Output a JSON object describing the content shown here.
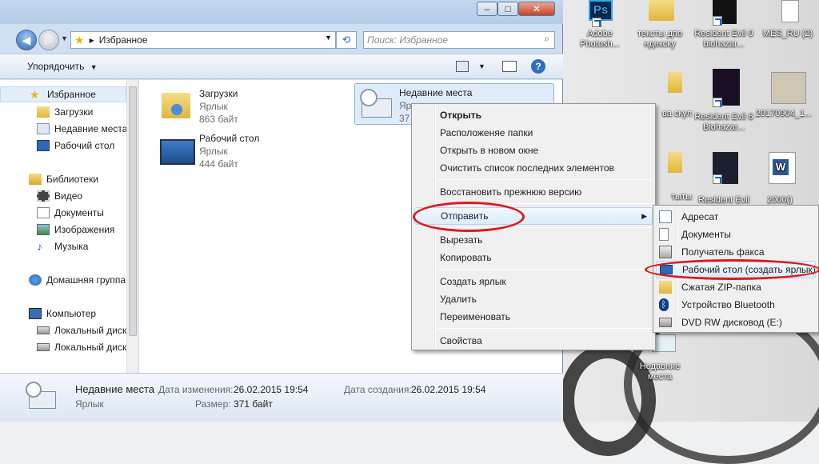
{
  "desktop": {
    "icons": [
      {
        "label": "Adobe Photosh...",
        "icon": "photoshop-icon"
      },
      {
        "label": "тексты дпо ндекску",
        "icon": "folder-icon"
      },
      {
        "label": "Resident Evil 0 biohazar...",
        "icon": "game-icon"
      },
      {
        "label": "MES_RU (2)",
        "icon": "document-icon"
      },
      {
        "label": "Resident Evil 6 Biohazar...",
        "icon": "game-icon"
      },
      {
        "label": "20170904_1...",
        "icon": "image-icon"
      },
      {
        "label": "ва скул",
        "icon": "folder-icon"
      },
      {
        "label": "Resident Evil",
        "icon": "game-icon"
      },
      {
        "label": "2000()",
        "icon": "word-document-icon"
      },
      {
        "label": "тыты",
        "icon": "folder-icon"
      },
      {
        "label": "Недавние места",
        "icon": "recent-places-icon"
      }
    ],
    "ps_logo": "Ps",
    "word_logo": "W"
  },
  "explorer": {
    "address": {
      "path": "Избранное",
      "breadcrumb_sep": "▶"
    },
    "search": {
      "placeholder": "Поиск: Избранное"
    },
    "toolbar": {
      "organize_label": "Упорядочить"
    },
    "nav": [
      {
        "label": "Избранное",
        "icon": "star-icon",
        "level": 0
      },
      {
        "label": "Загрузки",
        "icon": "downloads-folder-icon",
        "level": 1
      },
      {
        "label": "Недавние места",
        "icon": "recent-places-icon",
        "level": 1
      },
      {
        "label": "Рабочий стол",
        "icon": "desktop-icon",
        "level": 1
      },
      {
        "label": "Библиотеки",
        "icon": "libraries-icon",
        "level": 0
      },
      {
        "label": "Видео",
        "icon": "video-icon",
        "level": 1
      },
      {
        "label": "Документы",
        "icon": "documents-icon",
        "level": 1
      },
      {
        "label": "Изображения",
        "icon": "pictures-icon",
        "level": 1
      },
      {
        "label": "Музыка",
        "icon": "music-icon",
        "level": 1
      },
      {
        "label": "Домашняя группа",
        "icon": "homegroup-icon",
        "level": 0
      },
      {
        "label": "Компьютер",
        "icon": "computer-icon",
        "level": 0
      },
      {
        "label": "Локальный диск",
        "icon": "drive-icon",
        "level": 1
      },
      {
        "label": "Локальный диск",
        "icon": "drive-icon",
        "level": 1
      }
    ],
    "files": [
      {
        "name": "Загрузки",
        "type": "Ярлык",
        "size": "863 байт",
        "icon": "downloads-folder-icon"
      },
      {
        "name": "Рабочий стол",
        "type": "Ярлык",
        "size": "444 байт",
        "icon": "desktop-icon"
      },
      {
        "name": "Недавние места",
        "type": "Ярлык",
        "size": "37",
        "icon": "recent-places-icon"
      }
    ],
    "details": {
      "name": "Недавние места",
      "type": "Ярлык",
      "modified_label": "Дата изменения:",
      "modified_value": "26.02.2015 19:54",
      "size_label": "Размер:",
      "size_value": "371 байт",
      "created_label": "Дата создания:",
      "created_value": "26.02.2015 19:54"
    }
  },
  "context_menu": {
    "items": [
      {
        "label": "Открыть",
        "bold": true
      },
      {
        "label": "Расположеняе папки"
      },
      {
        "label": "Открыть в новом окне"
      },
      {
        "label": "Очистить список последних элементов"
      },
      {
        "label": "Восстановить прежнюю версию"
      },
      {
        "label": "Отправить",
        "submenu": true,
        "highlighted": true
      },
      {
        "label": "Вырезать"
      },
      {
        "label": "Копировать"
      },
      {
        "label": "Создать ярлык"
      },
      {
        "label": "Удалить"
      },
      {
        "label": "Переименовать"
      },
      {
        "label": "Свойства"
      }
    ]
  },
  "send_to_menu": {
    "items": [
      {
        "label": "Адресат",
        "icon": "mail-recipient-icon"
      },
      {
        "label": "Документы",
        "icon": "documents-icon"
      },
      {
        "label": "Получатель факса",
        "icon": "fax-icon"
      },
      {
        "label": "Рабочий стол (создать ярлык)",
        "icon": "desktop-icon",
        "highlighted": true
      },
      {
        "label": "Сжатая ZIP-папка",
        "icon": "zip-folder-icon"
      },
      {
        "label": "Устройство Bluetooth",
        "icon": "bluetooth-icon"
      },
      {
        "label": "DVD RW дисковод (E:)",
        "icon": "dvd-drive-icon"
      }
    ]
  },
  "colors": {
    "annotation_ring": "#e01818",
    "menu_highlight": "#dcebfc",
    "selection": "#dfebf9"
  }
}
